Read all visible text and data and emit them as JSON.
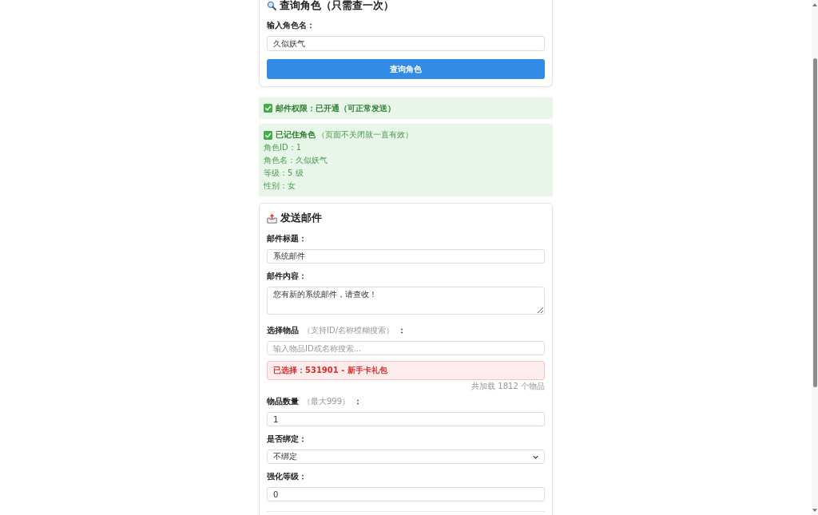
{
  "query_card": {
    "title": "查询角色（只需查一次）",
    "label": "输入角色名：",
    "value": "久似妖气",
    "button": "查询角色"
  },
  "mail_permission": {
    "text": "邮件权限：已开通（可正常发送）"
  },
  "remembered_role": {
    "title": "已记住角色",
    "note": "（页面不关闭就一直有效）",
    "lines": [
      "角色ID：1",
      "角色名：久似妖气",
      "等级：5 级",
      "性别：女"
    ]
  },
  "send_mail": {
    "title": "发送邮件",
    "fields": [
      {
        "kind": "input",
        "label": "邮件标题：",
        "value": "系统邮件"
      },
      {
        "kind": "textarea",
        "label": "邮件内容：",
        "value": "您有新的系统邮件，请查收！"
      },
      {
        "kind": "search",
        "label": "选择物品",
        "hint": "（支持ID/名称模糊搜索）",
        "colon": "：",
        "placeholder": "输入物品ID或名称搜索...",
        "selected_text": "已选择：531901 - 新手卡礼包",
        "count_text": "共加载 1812 个物品"
      },
      {
        "kind": "input",
        "label": "物品数量",
        "hint": "（最大999）",
        "colon": "：",
        "value": "1"
      },
      {
        "kind": "select",
        "label": "是否绑定：",
        "value": "不绑定"
      },
      {
        "kind": "input",
        "label": "强化等级：",
        "value": "0"
      }
    ]
  }
}
